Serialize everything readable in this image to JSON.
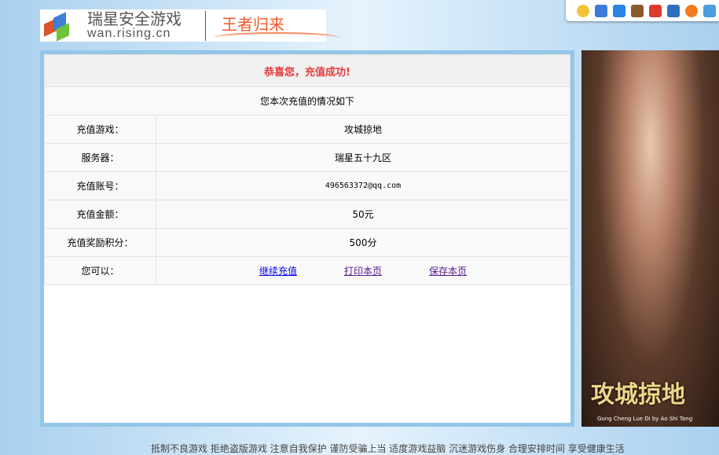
{
  "logo": {
    "brand_cn": "瑞星安全游戏",
    "brand_en": "wan.rising.cn",
    "slogan": "王者归来"
  },
  "toolbar": {
    "icons": [
      "star-icon",
      "screenshot-icon",
      "shield-check-icon",
      "box-icon",
      "notification-icon",
      "security-t-icon",
      "orange-circle-icon",
      "game-icon"
    ]
  },
  "result": {
    "title": "恭喜您，充值成功!",
    "subtitle": "您本次充值的情况如下",
    "rows": [
      {
        "label": "充值游戏：",
        "value": "攻城掠地"
      },
      {
        "label": "服务器：",
        "value": "瑞星五十九区"
      },
      {
        "label": "充值账号：",
        "value": "496563372@qq.com"
      },
      {
        "label": "充值金额：",
        "value": "50元"
      },
      {
        "label": "充值奖励积分：",
        "value": "500分"
      }
    ],
    "actions_label": "您可以：",
    "actions": [
      "继续充值",
      "打印本页",
      "保存本页"
    ]
  },
  "ad": {
    "title": "攻城掠地",
    "subtitle": "Gong Cheng Lue Di by Ao Shi Tang"
  },
  "footer": "抵制不良游戏 拒绝盗版游戏 注意自我保护 谨防受骗上当 适度游戏益脑 沉迷游戏伤身 合理安排时间 享受健康生活"
}
